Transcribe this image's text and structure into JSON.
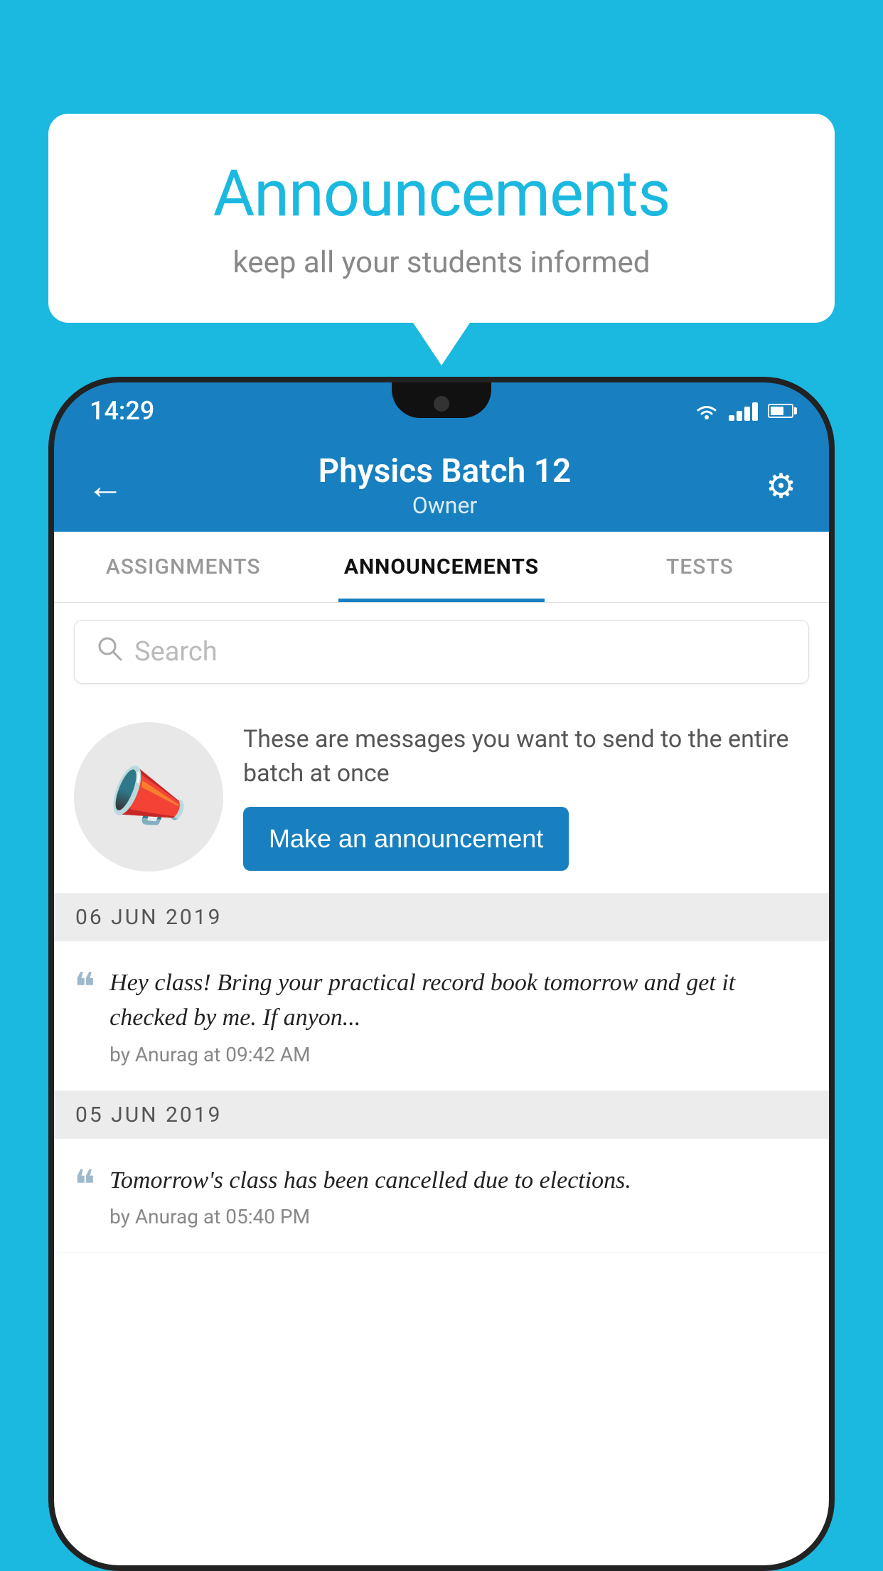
{
  "background_color": "#1bb8e0",
  "speech_bubble": {
    "title": "Announcements",
    "subtitle": "keep all your students informed"
  },
  "phone": {
    "status_bar": {
      "time": "14:29"
    },
    "header": {
      "title": "Physics Batch 12",
      "subtitle": "Owner",
      "back_label": "←",
      "gear_label": "⚙"
    },
    "tabs": [
      {
        "label": "ASSIGNMENTS",
        "active": false
      },
      {
        "label": "ANNOUNCEMENTS",
        "active": true
      },
      {
        "label": "TESTS",
        "active": false
      }
    ],
    "search": {
      "placeholder": "Search"
    },
    "cta": {
      "description": "These are messages you want to send to the entire batch at once",
      "button_label": "Make an announcement"
    },
    "announcements": [
      {
        "date_header": "06  JUN  2019",
        "text": "Hey class! Bring your practical record book tomorrow and get it checked by me. If anyon...",
        "meta": "by Anurag at 09:42 AM"
      },
      {
        "date_header": "05  JUN  2019",
        "text": "Tomorrow's class has been cancelled due to elections.",
        "meta": "by Anurag at 05:40 PM"
      }
    ]
  }
}
